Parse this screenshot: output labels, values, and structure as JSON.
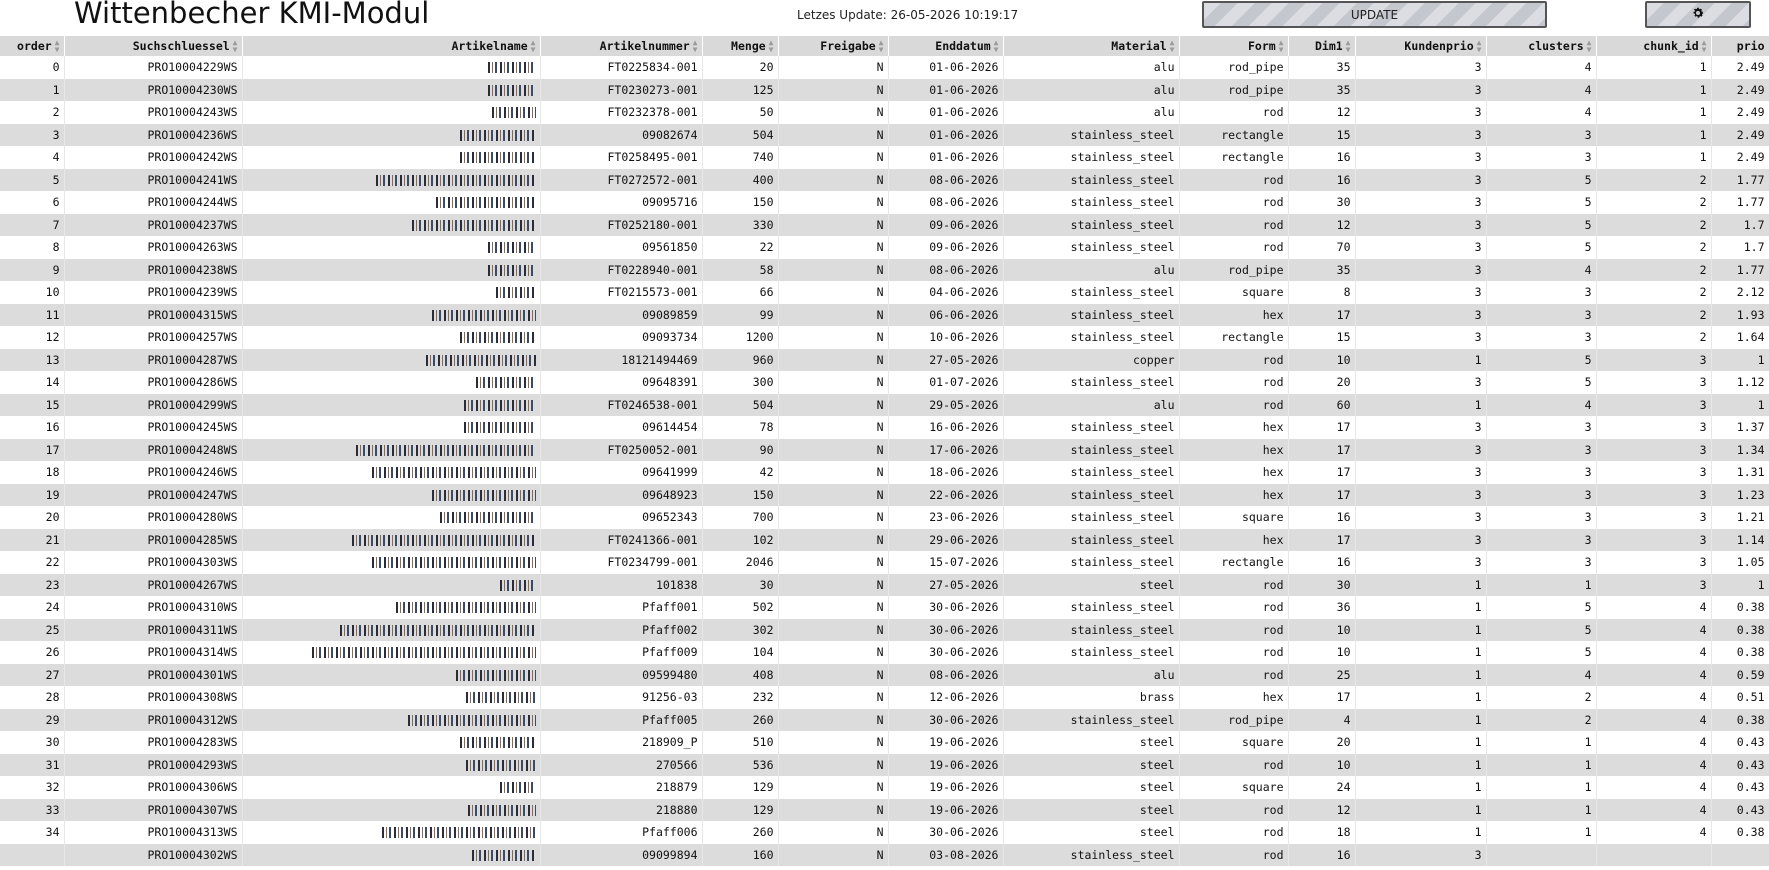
{
  "app": {
    "title": "Wittenbecher KMI-Modul",
    "last_update": "Letzes Update: 26-05-2026 10:19:17",
    "update_label": "UPDATE",
    "settings_icon": "gear-icon"
  },
  "table": {
    "columns": [
      "order",
      "Suchschluessel",
      "Artikelname",
      "Artikelnummer",
      "Menge",
      "Freigabe",
      "Enddatum",
      "Material",
      "Form",
      "Dim1",
      "Kundenprio",
      "clusters",
      "chunk_id",
      "prio"
    ],
    "name_note": "Artikelname values are obscured (pixelated) in the screenshot",
    "rows": [
      {
        "order": "0",
        "key": "PRO10004229WS",
        "nr": "FT0225834-001",
        "menge": "20",
        "freigabe": "N",
        "end": "01-06-2026",
        "material": "alu",
        "form": "rod_pipe",
        "dim1": "35",
        "kprio": "3",
        "clusters": "4",
        "chunk": "1",
        "prio": "2.49"
      },
      {
        "order": "1",
        "key": "PRO10004230WS",
        "nr": "FT0230273-001",
        "menge": "125",
        "freigabe": "N",
        "end": "01-06-2026",
        "material": "alu",
        "form": "rod_pipe",
        "dim1": "35",
        "kprio": "3",
        "clusters": "4",
        "chunk": "1",
        "prio": "2.49"
      },
      {
        "order": "2",
        "key": "PRO10004243WS",
        "nr": "FT0232378-001",
        "menge": "50",
        "freigabe": "N",
        "end": "01-06-2026",
        "material": "alu",
        "form": "rod",
        "dim1": "12",
        "kprio": "3",
        "clusters": "4",
        "chunk": "1",
        "prio": "2.49"
      },
      {
        "order": "3",
        "key": "PRO10004236WS",
        "nr": "09082674",
        "menge": "504",
        "freigabe": "N",
        "end": "01-06-2026",
        "material": "stainless_steel",
        "form": "rectangle",
        "dim1": "15",
        "kprio": "3",
        "clusters": "3",
        "chunk": "1",
        "prio": "2.49"
      },
      {
        "order": "4",
        "key": "PRO10004242WS",
        "nr": "FT0258495-001",
        "menge": "740",
        "freigabe": "N",
        "end": "01-06-2026",
        "material": "stainless_steel",
        "form": "rectangle",
        "dim1": "16",
        "kprio": "3",
        "clusters": "3",
        "chunk": "1",
        "prio": "2.49"
      },
      {
        "order": "5",
        "key": "PRO10004241WS",
        "nr": "FT0272572-001",
        "menge": "400",
        "freigabe": "N",
        "end": "08-06-2026",
        "material": "stainless_steel",
        "form": "rod",
        "dim1": "16",
        "kprio": "3",
        "clusters": "5",
        "chunk": "2",
        "prio": "1.77"
      },
      {
        "order": "6",
        "key": "PRO10004244WS",
        "nr": "09095716",
        "menge": "150",
        "freigabe": "N",
        "end": "08-06-2026",
        "material": "stainless_steel",
        "form": "rod",
        "dim1": "30",
        "kprio": "3",
        "clusters": "5",
        "chunk": "2",
        "prio": "1.77"
      },
      {
        "order": "7",
        "key": "PRO10004237WS",
        "nr": "FT0252180-001",
        "menge": "330",
        "freigabe": "N",
        "end": "09-06-2026",
        "material": "stainless_steel",
        "form": "rod",
        "dim1": "12",
        "kprio": "3",
        "clusters": "5",
        "chunk": "2",
        "prio": "1.7"
      },
      {
        "order": "8",
        "key": "PRO10004263WS",
        "nr": "09561850",
        "menge": "22",
        "freigabe": "N",
        "end": "09-06-2026",
        "material": "stainless_steel",
        "form": "rod",
        "dim1": "70",
        "kprio": "3",
        "clusters": "5",
        "chunk": "2",
        "prio": "1.7"
      },
      {
        "order": "9",
        "key": "PRO10004238WS",
        "nr": "FT0228940-001",
        "menge": "58",
        "freigabe": "N",
        "end": "08-06-2026",
        "material": "alu",
        "form": "rod_pipe",
        "dim1": "35",
        "kprio": "3",
        "clusters": "4",
        "chunk": "2",
        "prio": "1.77"
      },
      {
        "order": "10",
        "key": "PRO10004239WS",
        "nr": "FT0215573-001",
        "menge": "66",
        "freigabe": "N",
        "end": "04-06-2026",
        "material": "stainless_steel",
        "form": "square",
        "dim1": "8",
        "kprio": "3",
        "clusters": "3",
        "chunk": "2",
        "prio": "2.12"
      },
      {
        "order": "11",
        "key": "PRO10004315WS",
        "nr": "09089859",
        "menge": "99",
        "freigabe": "N",
        "end": "06-06-2026",
        "material": "stainless_steel",
        "form": "hex",
        "dim1": "17",
        "kprio": "3",
        "clusters": "3",
        "chunk": "2",
        "prio": "1.93"
      },
      {
        "order": "12",
        "key": "PRO10004257WS",
        "nr": "09093734",
        "menge": "1200",
        "freigabe": "N",
        "end": "10-06-2026",
        "material": "stainless_steel",
        "form": "rectangle",
        "dim1": "15",
        "kprio": "3",
        "clusters": "3",
        "chunk": "2",
        "prio": "1.64"
      },
      {
        "order": "13",
        "key": "PRO10004287WS",
        "nr": "18121494469",
        "menge": "960",
        "freigabe": "N",
        "end": "27-05-2026",
        "material": "copper",
        "form": "rod",
        "dim1": "10",
        "kprio": "1",
        "clusters": "5",
        "chunk": "3",
        "prio": "1"
      },
      {
        "order": "14",
        "key": "PRO10004286WS",
        "nr": "09648391",
        "menge": "300",
        "freigabe": "N",
        "end": "01-07-2026",
        "material": "stainless_steel",
        "form": "rod",
        "dim1": "20",
        "kprio": "3",
        "clusters": "5",
        "chunk": "3",
        "prio": "1.12"
      },
      {
        "order": "15",
        "key": "PRO10004299WS",
        "nr": "FT0246538-001",
        "menge": "504",
        "freigabe": "N",
        "end": "29-05-2026",
        "material": "alu",
        "form": "rod",
        "dim1": "60",
        "kprio": "1",
        "clusters": "4",
        "chunk": "3",
        "prio": "1"
      },
      {
        "order": "16",
        "key": "PRO10004245WS",
        "nr": "09614454",
        "menge": "78",
        "freigabe": "N",
        "end": "16-06-2026",
        "material": "stainless_steel",
        "form": "hex",
        "dim1": "17",
        "kprio": "3",
        "clusters": "3",
        "chunk": "3",
        "prio": "1.37"
      },
      {
        "order": "17",
        "key": "PRO10004248WS",
        "nr": "FT0250052-001",
        "menge": "90",
        "freigabe": "N",
        "end": "17-06-2026",
        "material": "stainless_steel",
        "form": "hex",
        "dim1": "17",
        "kprio": "3",
        "clusters": "3",
        "chunk": "3",
        "prio": "1.34"
      },
      {
        "order": "18",
        "key": "PRO10004246WS",
        "nr": "09641999",
        "menge": "42",
        "freigabe": "N",
        "end": "18-06-2026",
        "material": "stainless_steel",
        "form": "hex",
        "dim1": "17",
        "kprio": "3",
        "clusters": "3",
        "chunk": "3",
        "prio": "1.31"
      },
      {
        "order": "19",
        "key": "PRO10004247WS",
        "nr": "09648923",
        "menge": "150",
        "freigabe": "N",
        "end": "22-06-2026",
        "material": "stainless_steel",
        "form": "hex",
        "dim1": "17",
        "kprio": "3",
        "clusters": "3",
        "chunk": "3",
        "prio": "1.23"
      },
      {
        "order": "20",
        "key": "PRO10004280WS",
        "nr": "09652343",
        "menge": "700",
        "freigabe": "N",
        "end": "23-06-2026",
        "material": "stainless_steel",
        "form": "square",
        "dim1": "16",
        "kprio": "3",
        "clusters": "3",
        "chunk": "3",
        "prio": "1.21"
      },
      {
        "order": "21",
        "key": "PRO10004285WS",
        "nr": "FT0241366-001",
        "menge": "102",
        "freigabe": "N",
        "end": "29-06-2026",
        "material": "stainless_steel",
        "form": "hex",
        "dim1": "17",
        "kprio": "3",
        "clusters": "3",
        "chunk": "3",
        "prio": "1.14"
      },
      {
        "order": "22",
        "key": "PRO10004303WS",
        "nr": "FT0234799-001",
        "menge": "2046",
        "freigabe": "N",
        "end": "15-07-2026",
        "material": "stainless_steel",
        "form": "rectangle",
        "dim1": "16",
        "kprio": "3",
        "clusters": "3",
        "chunk": "3",
        "prio": "1.05"
      },
      {
        "order": "23",
        "key": "PRO10004267WS",
        "nr": "101838",
        "menge": "30",
        "freigabe": "N",
        "end": "27-05-2026",
        "material": "steel",
        "form": "rod",
        "dim1": "30",
        "kprio": "1",
        "clusters": "1",
        "chunk": "3",
        "prio": "1"
      },
      {
        "order": "24",
        "key": "PRO10004310WS",
        "nr": "Pfaff001",
        "menge": "502",
        "freigabe": "N",
        "end": "30-06-2026",
        "material": "stainless_steel",
        "form": "rod",
        "dim1": "36",
        "kprio": "1",
        "clusters": "5",
        "chunk": "4",
        "prio": "0.38"
      },
      {
        "order": "25",
        "key": "PRO10004311WS",
        "nr": "Pfaff002",
        "menge": "302",
        "freigabe": "N",
        "end": "30-06-2026",
        "material": "stainless_steel",
        "form": "rod",
        "dim1": "10",
        "kprio": "1",
        "clusters": "5",
        "chunk": "4",
        "prio": "0.38"
      },
      {
        "order": "26",
        "key": "PRO10004314WS",
        "nr": "Pfaff009",
        "menge": "104",
        "freigabe": "N",
        "end": "30-06-2026",
        "material": "stainless_steel",
        "form": "rod",
        "dim1": "10",
        "kprio": "1",
        "clusters": "5",
        "chunk": "4",
        "prio": "0.38"
      },
      {
        "order": "27",
        "key": "PRO10004301WS",
        "nr": "09599480",
        "menge": "408",
        "freigabe": "N",
        "end": "08-06-2026",
        "material": "alu",
        "form": "rod",
        "dim1": "25",
        "kprio": "1",
        "clusters": "4",
        "chunk": "4",
        "prio": "0.59"
      },
      {
        "order": "28",
        "key": "PRO10004308WS",
        "nr": "91256-03",
        "menge": "232",
        "freigabe": "N",
        "end": "12-06-2026",
        "material": "brass",
        "form": "hex",
        "dim1": "17",
        "kprio": "1",
        "clusters": "2",
        "chunk": "4",
        "prio": "0.51"
      },
      {
        "order": "29",
        "key": "PRO10004312WS",
        "nr": "Pfaff005",
        "menge": "260",
        "freigabe": "N",
        "end": "30-06-2026",
        "material": "stainless_steel",
        "form": "rod_pipe",
        "dim1": "4",
        "kprio": "1",
        "clusters": "2",
        "chunk": "4",
        "prio": "0.38"
      },
      {
        "order": "30",
        "key": "PRO10004283WS",
        "nr": "218909_P",
        "menge": "510",
        "freigabe": "N",
        "end": "19-06-2026",
        "material": "steel",
        "form": "square",
        "dim1": "20",
        "kprio": "1",
        "clusters": "1",
        "chunk": "4",
        "prio": "0.43"
      },
      {
        "order": "31",
        "key": "PRO10004293WS",
        "nr": "270566",
        "menge": "536",
        "freigabe": "N",
        "end": "19-06-2026",
        "material": "steel",
        "form": "rod",
        "dim1": "10",
        "kprio": "1",
        "clusters": "1",
        "chunk": "4",
        "prio": "0.43"
      },
      {
        "order": "32",
        "key": "PRO10004306WS",
        "nr": "218879",
        "menge": "129",
        "freigabe": "N",
        "end": "19-06-2026",
        "material": "steel",
        "form": "square",
        "dim1": "24",
        "kprio": "1",
        "clusters": "1",
        "chunk": "4",
        "prio": "0.43"
      },
      {
        "order": "33",
        "key": "PRO10004307WS",
        "nr": "218880",
        "menge": "129",
        "freigabe": "N",
        "end": "19-06-2026",
        "material": "steel",
        "form": "rod",
        "dim1": "12",
        "kprio": "1",
        "clusters": "1",
        "chunk": "4",
        "prio": "0.43"
      },
      {
        "order": "34",
        "key": "PRO10004313WS",
        "nr": "Pfaff006",
        "menge": "260",
        "freigabe": "N",
        "end": "30-06-2026",
        "material": "steel",
        "form": "rod",
        "dim1": "18",
        "kprio": "1",
        "clusters": "1",
        "chunk": "4",
        "prio": "0.38"
      },
      {
        "order": "",
        "key": "PRO10004302WS",
        "nr": "09099894",
        "menge": "160",
        "freigabe": "N",
        "end": "03-08-2026",
        "material": "stainless_steel",
        "form": "rod",
        "dim1": "16",
        "kprio": "3",
        "clusters": "",
        "chunk": "",
        "prio": ""
      }
    ]
  }
}
